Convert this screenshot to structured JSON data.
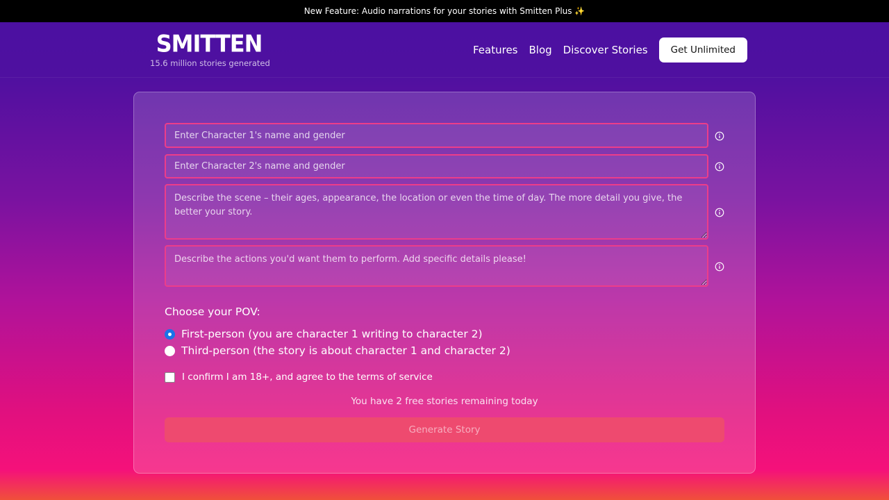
{
  "banner": {
    "text": "New Feature: Audio narrations for your stories with Smitten Plus ✨"
  },
  "header": {
    "logo": "SMITTEN",
    "tagline": "15.6 million stories generated",
    "nav": [
      {
        "label": "Features"
      },
      {
        "label": "Blog"
      },
      {
        "label": "Discover Stories"
      }
    ],
    "cta": "Get Unlimited"
  },
  "form": {
    "character1_placeholder": "Enter Character 1's name and gender",
    "character2_placeholder": "Enter Character 2's name and gender",
    "scene_placeholder": "Describe the scene – their ages, appearance, the location or even the time of day. The more detail you give, the better your story.",
    "actions_placeholder": "Describe the actions you'd want them to perform. Add specific details please!",
    "pov_title": "Choose your POV:",
    "pov_options": [
      {
        "label": "First-person (you are character 1 writing to character 2)",
        "selected": true
      },
      {
        "label": "Third-person (the story is about character 1 and character 2)",
        "selected": false
      }
    ],
    "confirm_label": "I confirm I am 18+, and agree to the terms of service",
    "remaining_text": "You have 2 free stories remaining today",
    "submit_label": "Generate Story"
  },
  "colors": {
    "field_border": "#ec3d8a",
    "radio_selected": "#1a73e8",
    "button_bg": "#ee4a6f"
  },
  "icons": {
    "field_info": "info-circle-icon"
  }
}
